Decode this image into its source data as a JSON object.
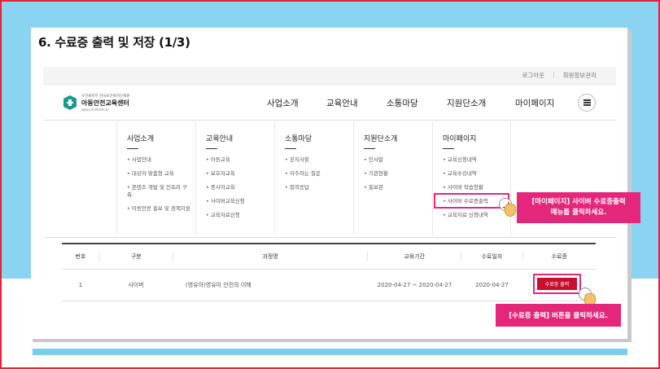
{
  "slide": {
    "title": "6. 수료증 출력 및 저장 (1/3)"
  },
  "top_links": {
    "logout": "로그아웃",
    "mypage_admin": "회원정보관리"
  },
  "logo": {
    "sub": "보건복지부 한국보건복지인재원",
    "name": "아동안전교육센터",
    "url": "www.childsafe.kr"
  },
  "gnb": [
    {
      "label": "사업소개"
    },
    {
      "label": "교육안내"
    },
    {
      "label": "소통마당"
    },
    {
      "label": "지원단소개"
    },
    {
      "label": "마이페이지"
    }
  ],
  "mega_menu": [
    {
      "title": "사업소개",
      "items": [
        "사업안내",
        "대상자 맞춤형 교육",
        "콘텐츠 개발 및 인프라 구축",
        "아동안전 홍보 및 정책지원"
      ]
    },
    {
      "title": "교육안내",
      "items": [
        "아동교육",
        "보호자교육",
        "종사자교육",
        "사이버교육신청",
        "교육자료신청"
      ]
    },
    {
      "title": "소통마당",
      "items": [
        "공지사항",
        "자주하는 질문",
        "질의응답"
      ]
    },
    {
      "title": "지원단소개",
      "items": [
        "인사말",
        "기관현황",
        "홍보관"
      ]
    },
    {
      "title": "마이페이지",
      "items": [
        "교육신청내역",
        "교육수강내역",
        "사이버 학습현황",
        "사이버 수료증출력",
        "교육자료 신청내역"
      ]
    }
  ],
  "callout_menu": {
    "line1": "[마이페이지] 사이버 수료증출력",
    "line2": "메뉴를 클릭하세요."
  },
  "table": {
    "headers": [
      "번호",
      "구분",
      "과정명",
      "교육기간",
      "수료일자",
      "수료증"
    ],
    "row": {
      "no": "1",
      "type": "사이버",
      "course": "(영유아)영유아 안전의 이해",
      "period": "2020-04-27 ~ 2020-04-27",
      "completed": "2020-04-27",
      "button": "수료증 출력"
    }
  },
  "callout_button": "[수료증 출력] 버튼을 클릭하세요.",
  "colors": {
    "frame": "#e8203a",
    "sky": "#8ad4f2",
    "accent": "#e4277a",
    "button": "#c8102e"
  }
}
